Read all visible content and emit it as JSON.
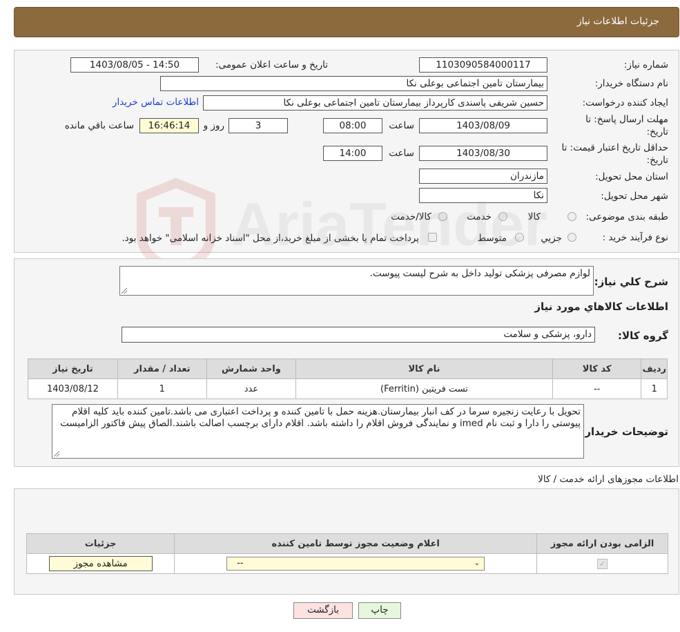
{
  "header": {
    "title": "جزئیات اطلاعات نیاز"
  },
  "info": {
    "need_number_label": "شماره نیاز:",
    "need_number": "1103090584000117",
    "announce_label": "تاریخ و ساعت اعلان عمومی:",
    "announce_value": "1403/08/05 - 14:50",
    "buyer_org_label": "نام دستگاه خریدار:",
    "buyer_org": "بیمارستان تامین اجتماعی بوعلی نکا",
    "creator_label": "ایجاد کننده درخواست:",
    "creator": "حسین شریفی پاسندی کارپرداز بیمارستان تامین اجتماعی بوعلی نکا",
    "contact_link": "اطلاعات تماس خریدار",
    "reply_deadline_label": "مهلت ارسال پاسخ: تا تاریخ:",
    "reply_date": "1403/08/09",
    "time_label": "ساعت",
    "reply_time": "08:00",
    "days_value": "3",
    "days_label": "روز و",
    "remaining_time": "16:46:14",
    "remaining_label": "ساعت باقي مانده",
    "price_validity_label": "حداقل تاریخ اعتبار قیمت: تا تاریخ:",
    "price_date": "1403/08/30",
    "price_time": "14:00",
    "province_label": "استان محل تحویل:",
    "province": "مازندران",
    "city_label": "شهر محل تحویل:",
    "city": "نکا",
    "category_label": "طبقه بندی موضوعی:",
    "category_options": [
      "کالا",
      "خدمت",
      "کالا/خدمت"
    ],
    "process_label": "نوع فرآیند خرید :",
    "process_options": [
      "جزيي",
      "متوسط"
    ],
    "process_note": "پرداخت تمام یا بخشی از مبلغ خرید،از محل \"اسناد خزانه اسلامی\" خواهد بود."
  },
  "description": {
    "label": "شرح کلي نياز:",
    "text": "لوازم مصرفی پزشکی تولید داخل به شرح لیست پیوست.",
    "goods_title": "اطلاعات کالاهاي مورد نياز",
    "group_label": "گروه کالا:",
    "group_value": "دارو، پزشکی و سلامت",
    "table_headers": [
      "رديف",
      "کد کالا",
      "نام کالا",
      "واحد شمارش",
      "تعداد / مقدار",
      "تاریخ نیاز"
    ],
    "rows": [
      [
        "1",
        "--",
        "تست فریتین (Ferritin)",
        "عدد",
        "1",
        "1403/08/12"
      ]
    ],
    "buyer_notes_label": "توضیحات خریدار:",
    "buyer_notes": "تحویل با رعایت زنجیره سرما در کف انبار بیمارستان.هزینه حمل با تامین کننده و پرداخت اعتباری می باشد.تامین کننده باید کلیه اقلام پیوستی را دارا و ثبت نام imed و نمایندگی فروش اقلام را داشته باشد. اقلام دارای برچسب اصالت باشند.الصاق پیش فاکتور الزامیست"
  },
  "permits": {
    "title": "اطلاعات مجوزهای ارائه خدمت / کالا",
    "table_headers": [
      "الزامی بودن ارائه مجوز",
      "اعلام وضعیت مجوز توسط تامین کننده",
      "جزئیات"
    ],
    "select_value": "--",
    "view_button": "مشاهده مجوز"
  },
  "footer": {
    "print_button": "چاپ",
    "back_button": "بازگشت"
  },
  "watermark": {
    "text": "AriaTender.neT"
  },
  "colors": {
    "header_bg": "#8c6a3e",
    "link": "#1a3fcf",
    "highlight": "#fffbd6",
    "back_button": "#fde2e2",
    "print_button": "#e6f7de"
  }
}
